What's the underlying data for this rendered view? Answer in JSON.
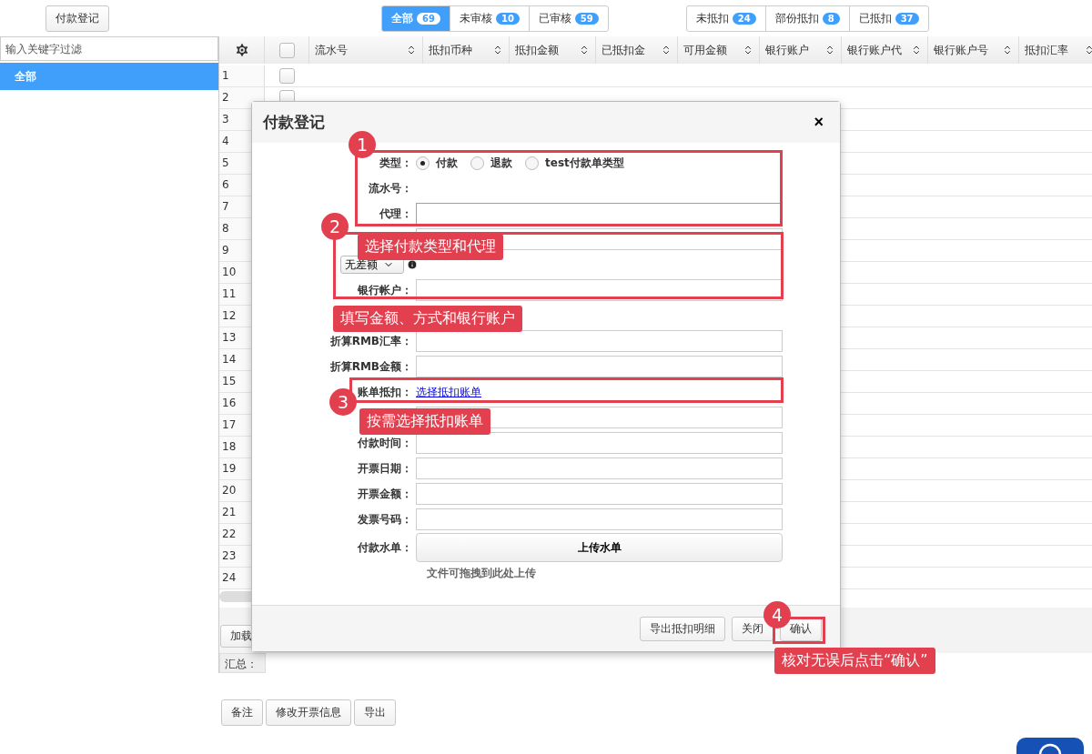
{
  "toolbar": {
    "register_button": "付款登记"
  },
  "status_tabs": [
    {
      "label": "全部",
      "count": "69",
      "selected": true
    },
    {
      "label": "未审核",
      "count": "10",
      "selected": false
    },
    {
      "label": "已审核",
      "count": "59",
      "selected": false
    }
  ],
  "deduct_tabs": [
    {
      "label": "未抵扣",
      "count": "24",
      "selected": false
    },
    {
      "label": "部份抵扣",
      "count": "8",
      "selected": false
    },
    {
      "label": "已抵扣",
      "count": "37",
      "selected": false
    }
  ],
  "sidebar": {
    "filter_placeholder": "输入关键字过滤",
    "items": [
      {
        "label": "全部",
        "selected": true
      }
    ]
  },
  "grid": {
    "header_checked": false,
    "columns": [
      "流水号",
      "抵扣币种",
      "抵扣金额",
      "已抵扣金",
      "可用金额",
      "银行账户",
      "银行账户代",
      "银行账户号",
      "抵扣汇率"
    ],
    "rows": [
      {
        "number": "1",
        "checked": false
      },
      {
        "number": "2",
        "checked": false
      },
      {
        "number": "3"
      },
      {
        "number": "4"
      },
      {
        "number": "5"
      },
      {
        "number": "6"
      },
      {
        "number": "7"
      },
      {
        "number": "8"
      },
      {
        "number": "9"
      },
      {
        "number": "10"
      },
      {
        "number": "11"
      },
      {
        "number": "12"
      },
      {
        "number": "13"
      },
      {
        "number": "14"
      },
      {
        "number": "15"
      },
      {
        "number": "16"
      },
      {
        "number": "17"
      },
      {
        "number": "18"
      },
      {
        "number": "19"
      },
      {
        "number": "20"
      },
      {
        "number": "21"
      },
      {
        "number": "22"
      },
      {
        "number": "23"
      },
      {
        "number": "24"
      }
    ],
    "load_button": "加载",
    "summary_label": "汇总："
  },
  "bottom_buttons": [
    "备注",
    "修改开票信息",
    "导出"
  ],
  "dialog": {
    "title": "付款登记",
    "close": "×",
    "fields": [
      {
        "kind": "radio",
        "label": "类型：",
        "options": [
          {
            "label": "付款",
            "selected": true
          },
          {
            "label": "退款",
            "selected": false
          },
          {
            "label": "test付款单类型",
            "selected": false
          }
        ]
      },
      {
        "kind": "text",
        "label": "流水号："
      },
      {
        "kind": "input",
        "label": "代理：",
        "focused": true
      },
      {
        "kind": "input",
        "focused": false
      },
      {
        "kind": "select",
        "value": "无差额"
      },
      {
        "kind": "input",
        "label": "银行帐户：",
        "focused": false
      },
      {
        "kind": "blank"
      },
      {
        "kind": "input",
        "label": "折算RMB汇率：",
        "focused": false
      },
      {
        "kind": "input",
        "label": "折算RMB金额：",
        "focused": false
      },
      {
        "kind": "link",
        "label": "账单抵扣：",
        "link": "选择抵扣账单"
      },
      {
        "kind": "input",
        "focused": false
      },
      {
        "kind": "input",
        "label": "付款时间：",
        "focused": false
      },
      {
        "kind": "input",
        "label": "开票日期：",
        "focused": false
      },
      {
        "kind": "input",
        "label": "开票金额：",
        "focused": false
      },
      {
        "kind": "input",
        "label": "发票号码：",
        "focused": false
      },
      {
        "kind": "upload",
        "label": "付款水单：",
        "button": "上传水单",
        "hint": "文件可拖拽到此处上传"
      }
    ],
    "footer_buttons": [
      "导出抵扣明细",
      "关闭",
      "确认"
    ]
  },
  "callouts": [
    {
      "number": "1",
      "note": "选择付款类型和代理"
    },
    {
      "number": "2",
      "note": "填写金额、方式和银行账户"
    },
    {
      "number": "3",
      "note": "按需选择抵扣账单"
    },
    {
      "number": "4",
      "note": "核对无误后点击“确认”"
    }
  ]
}
